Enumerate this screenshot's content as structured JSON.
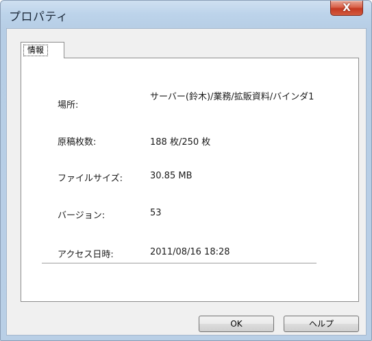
{
  "window": {
    "title": "プロパティ",
    "close_label": "X"
  },
  "tabs": [
    {
      "label": "情報",
      "selected": true
    }
  ],
  "info": {
    "location_label": "場所:",
    "location_value": "サーバー(鈴木)/業務/拡販資料/バインダ1",
    "pages_label": "原稿枚数:",
    "pages_value": "188 枚/250 枚",
    "filesize_label": "ファイルサイズ:",
    "filesize_value": "30.85 MB",
    "version_label": "バージョン:",
    "version_value": "53",
    "access_label": "アクセス日時:",
    "access_value": "2011/08/16  18:28"
  },
  "buttons": {
    "ok_label": "OK",
    "help_label": "ヘルプ"
  },
  "colors": {
    "title_bar": "#bcd3ea",
    "close_button": "#c43a22",
    "client_background": "#f0f0f0",
    "panel_background": "#ffffff"
  }
}
